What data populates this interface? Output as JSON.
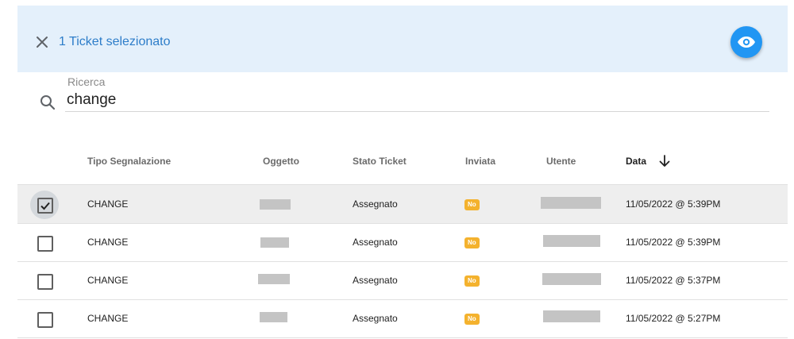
{
  "selection": {
    "text": "1 Ticket selezionato"
  },
  "search": {
    "label": "Ricerca",
    "value": "change"
  },
  "table": {
    "columns": [
      "Tipo Segnalazione",
      "Oggetto",
      "Stato Ticket",
      "Inviata",
      "Utente",
      "Data"
    ],
    "rows": [
      {
        "tipo": "CHANGE",
        "stato": "Assegnato",
        "inviata": "No",
        "data": "11/05/2022 @ 5:39PM",
        "checked": true
      },
      {
        "tipo": "CHANGE",
        "stato": "Assegnato",
        "inviata": "No",
        "data": "11/05/2022 @ 5:39PM",
        "checked": false
      },
      {
        "tipo": "CHANGE",
        "stato": "Assegnato",
        "inviata": "No",
        "data": "11/05/2022 @ 5:37PM",
        "checked": false
      },
      {
        "tipo": "CHANGE",
        "stato": "Assegnato",
        "inviata": "No",
        "data": "11/05/2022 @ 5:27PM",
        "checked": false
      }
    ]
  },
  "icons": {
    "close": "close-icon",
    "view": "eye-icon",
    "search": "search-icon",
    "sort": "arrow-down-icon",
    "check": "check-icon"
  },
  "colors": {
    "accent": "#2196f3",
    "selection_bg": "#e4f0fb",
    "badge": "#f4b22e"
  }
}
